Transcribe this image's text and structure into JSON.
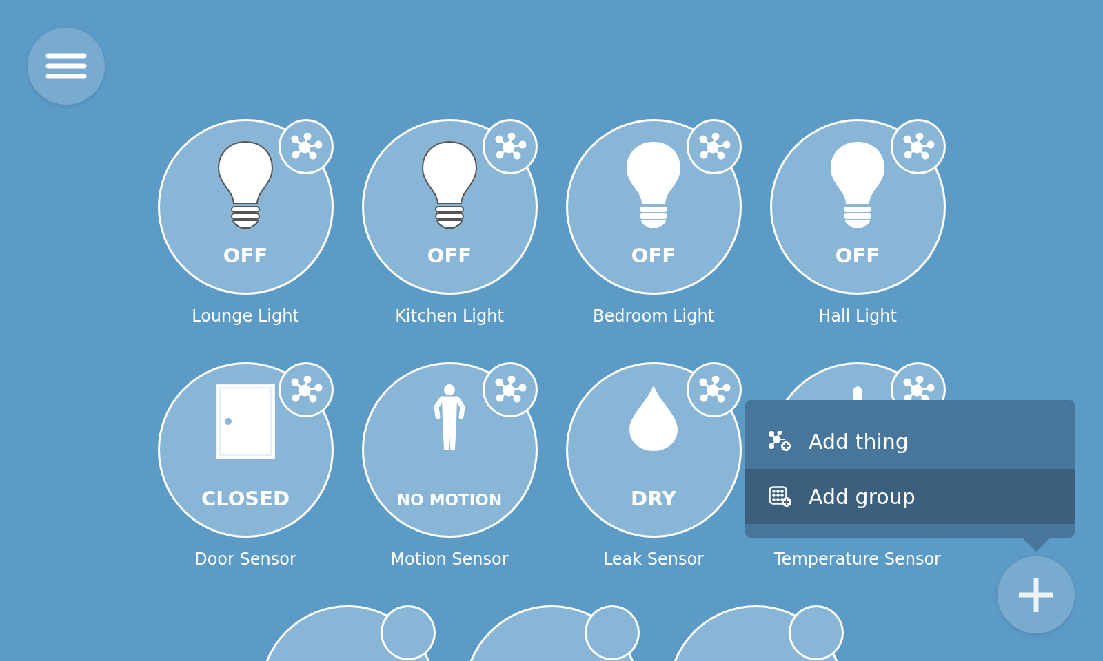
{
  "things": [
    {
      "name": "Lounge Light",
      "state": "OFF",
      "kind": "outlinelight"
    },
    {
      "name": "Kitchen Light",
      "state": "OFF",
      "kind": "outlinelight"
    },
    {
      "name": "Bedroom Light",
      "state": "OFF",
      "kind": "light"
    },
    {
      "name": "Hall Light",
      "state": "OFF",
      "kind": "light"
    },
    {
      "name": "Door Sensor",
      "state": "CLOSED",
      "kind": "door"
    },
    {
      "name": "Motion Sensor",
      "state": "NO MOTION",
      "kind": "motion"
    },
    {
      "name": "Leak Sensor",
      "state": "DRY",
      "kind": "leak"
    },
    {
      "name": "Temperature Sensor",
      "kind": "temperature"
    }
  ],
  "add_menu": {
    "items": [
      {
        "label": "Add thing",
        "kind": "thing",
        "highlighted": false
      },
      {
        "label": "Add group",
        "kind": "group",
        "highlighted": true
      }
    ]
  }
}
